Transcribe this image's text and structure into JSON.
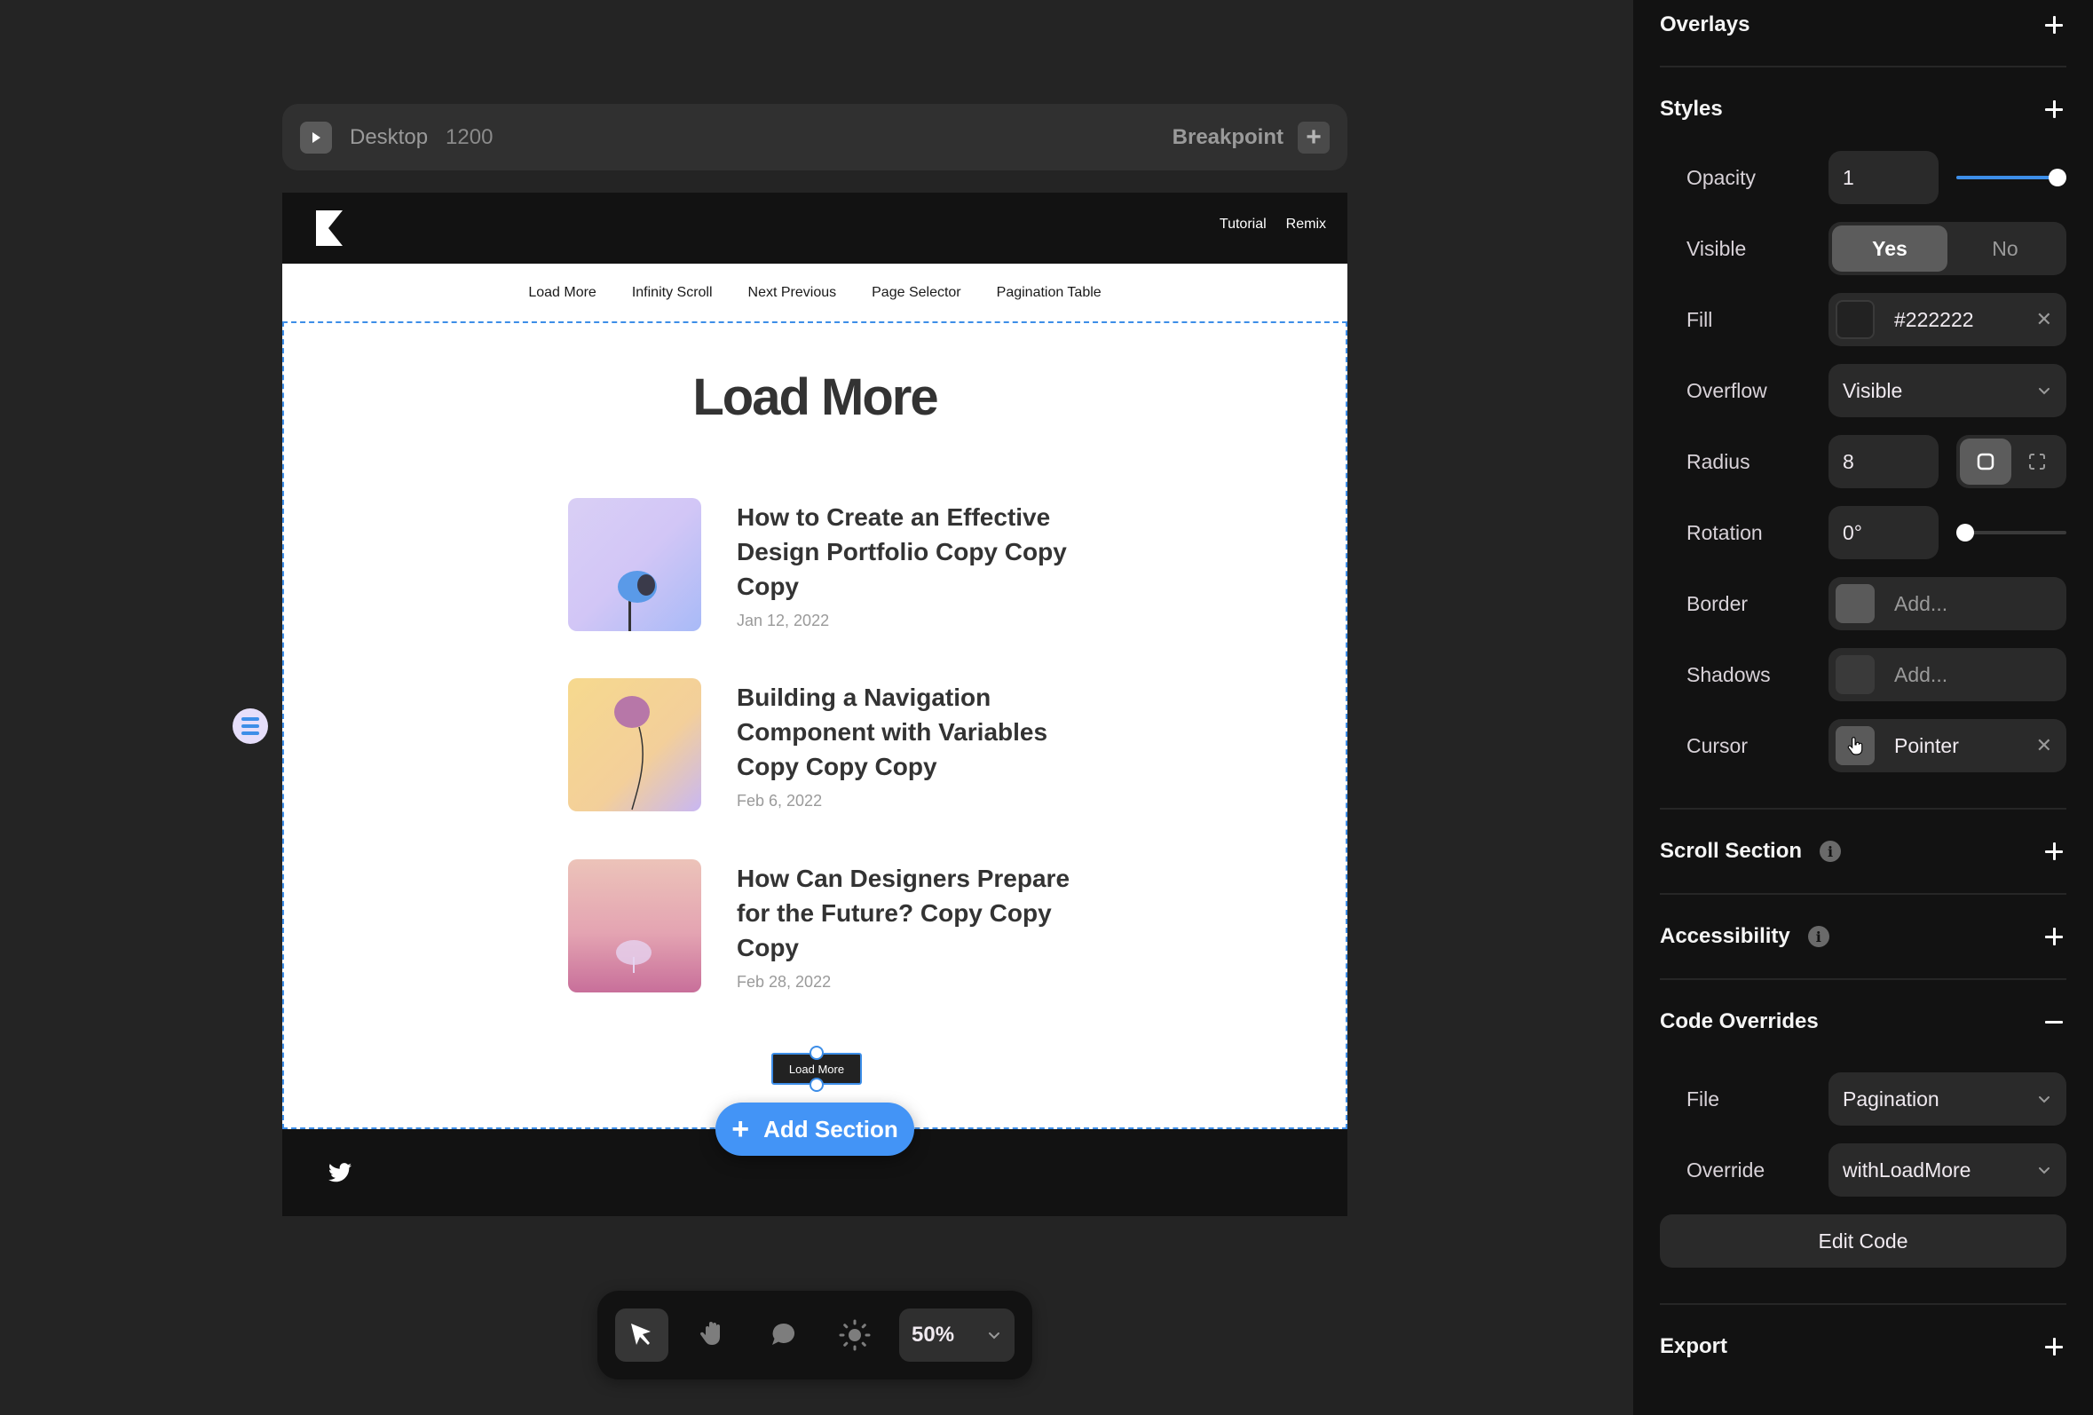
{
  "breakpoint_bar": {
    "device": "Desktop",
    "width": "1200",
    "breakpoint_label": "Breakpoint"
  },
  "site": {
    "header_links": [
      "Tutorial",
      "Remix"
    ],
    "nav": [
      "Load More",
      "Infinity Scroll",
      "Next Previous",
      "Page Selector",
      "Pagination Table"
    ],
    "heading": "Load More",
    "posts": [
      {
        "title": "How to Create an Effective Design Portfolio Copy Copy Copy",
        "date": "Jan 12, 2022",
        "thumb": "lavender-blue-tree"
      },
      {
        "title": "Building a Navigation Component with Variables Copy Copy Copy",
        "date": "Feb 6, 2022",
        "thumb": "yellow-pink-branch"
      },
      {
        "title": "How Can Designers Prepare for the Future? Copy Copy Copy",
        "date": "Feb 28, 2022",
        "thumb": "pink-gradient-plant"
      }
    ],
    "load_more_button": "Load More"
  },
  "add_section": {
    "label": "Add Section"
  },
  "toolbar": {
    "tools": [
      {
        "name": "select",
        "icon": "cursor-arrow-icon",
        "active": true
      },
      {
        "name": "hand",
        "icon": "hand-icon",
        "active": false
      },
      {
        "name": "comment",
        "icon": "comment-icon",
        "active": false
      },
      {
        "name": "theme",
        "icon": "sun-icon",
        "active": false
      }
    ],
    "zoom": "50%"
  },
  "panel": {
    "sections": {
      "overlays": "Overlays",
      "styles": "Styles",
      "scroll_section": "Scroll Section",
      "accessibility": "Accessibility",
      "code_overrides": "Code Overrides",
      "export": "Export"
    },
    "styles": {
      "opacity": {
        "label": "Opacity",
        "value": "1",
        "slider_fraction": 1.0
      },
      "visible": {
        "label": "Visible",
        "options": [
          "Yes",
          "No"
        ],
        "selected": "Yes"
      },
      "fill": {
        "label": "Fill",
        "value": "#222222",
        "color": "#222222"
      },
      "overflow": {
        "label": "Overflow",
        "value": "Visible"
      },
      "radius": {
        "label": "Radius",
        "value": "8",
        "mode": "uniform"
      },
      "rotation": {
        "label": "Rotation",
        "value": "0°",
        "slider_fraction": 0.0
      },
      "border": {
        "label": "Border",
        "placeholder": "Add..."
      },
      "shadows": {
        "label": "Shadows",
        "placeholder": "Add..."
      },
      "cursor": {
        "label": "Cursor",
        "value": "Pointer"
      }
    },
    "code_overrides": {
      "file": {
        "label": "File",
        "value": "Pagination"
      },
      "override": {
        "label": "Override",
        "value": "withLoadMore"
      },
      "edit_button": "Edit Code"
    }
  },
  "colors": {
    "accent": "#4394f6",
    "canvas_bg": "#242424",
    "panel_bg": "#121212",
    "selection": "#3d8ee8"
  }
}
